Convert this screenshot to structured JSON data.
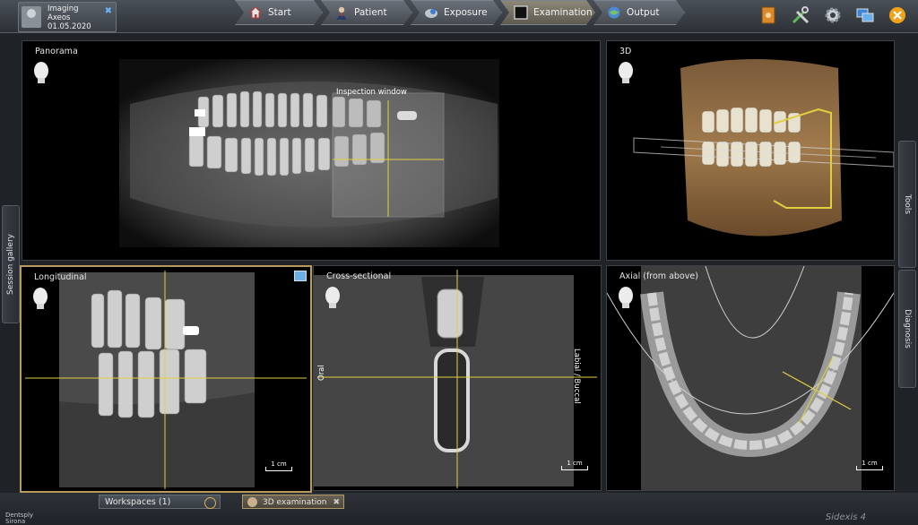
{
  "patient": {
    "line1": "Imaging",
    "line2": "Axeos",
    "line3": "01.05.2020"
  },
  "workflow": {
    "steps": [
      {
        "label": "Start",
        "icon": "house-icon"
      },
      {
        "label": "Patient",
        "icon": "person-icon"
      },
      {
        "label": "Exposure",
        "icon": "xray-source-icon"
      },
      {
        "label": "Examination",
        "icon": "monitor-icon"
      },
      {
        "label": "Output",
        "icon": "globe-output-icon"
      }
    ],
    "active": "Examination"
  },
  "toolbar_icons": [
    "book-icon",
    "tools-icon",
    "gear-icon",
    "screens-icon",
    "close-icon"
  ],
  "panes": {
    "panorama": {
      "label": "Panorama",
      "inspection": "Inspection window"
    },
    "three_d": {
      "label": "3D"
    },
    "longitudinal": {
      "label": "Longitudinal",
      "scale": "1 cm"
    },
    "cross": {
      "label": "Cross-sectional",
      "left_label": "Oral",
      "right_label": "Labial / Buccal",
      "scale": "1 cm"
    },
    "axial": {
      "label": "Axial (from above)",
      "scale": "1 cm"
    }
  },
  "side_tabs": {
    "left": "Session gallery",
    "right_top": "Tools",
    "right_bottom": "Diagnosis"
  },
  "bottom": {
    "workspaces": "Workspaces (1)",
    "exam_tab": "3D examination",
    "brand_line1": "Dentsply",
    "brand_line2": "Sirona",
    "version": "Sidexis 4"
  },
  "colors": {
    "accent_gold": "#b89a5a",
    "crosshair": "#e0d040",
    "bg": "#1f2227"
  }
}
